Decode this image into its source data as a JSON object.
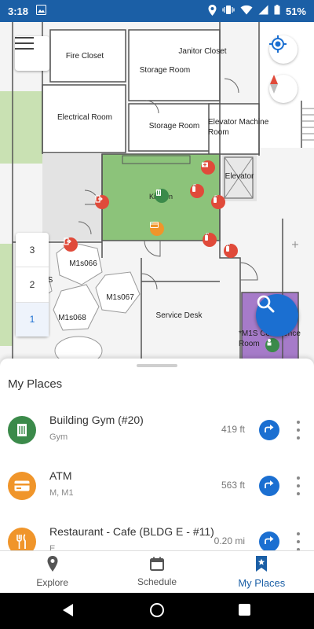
{
  "status_bar": {
    "time": "3:18",
    "battery": "51%"
  },
  "map": {
    "rooms": {
      "fire_closet": "Fire Closet",
      "janitor_closet": "Janitor Closet",
      "storage_room_1": "Storage Room",
      "electrical_room": "Electrical Room",
      "storage_room_2": "Storage Room",
      "elevator_machine_room": "Elevator Machine Room",
      "elevator": "Elevator",
      "kitchen": "Kitchen",
      "m1s066": "M1s066",
      "m1s067": "M1s067",
      "m1s068": "M1s068",
      "service_desk": "Service Desk",
      "conference_room": "*M1S Conference Room",
      "partial_s": "S"
    },
    "floors": [
      "3",
      "2",
      "1"
    ],
    "active_floor": "1",
    "icons": {
      "menu": "menu-icon",
      "locate": "my-location-icon",
      "compass": "compass-icon",
      "search": "search-icon"
    }
  },
  "my_places": {
    "title": "My Places",
    "items": [
      {
        "name": "Building Gym (#20)",
        "category": "Gym",
        "distance": "419 ft",
        "icon": "building-icon",
        "color": "#3b8a4a"
      },
      {
        "name": "ATM",
        "category": "M, M1",
        "distance": "563 ft",
        "icon": "credit-card-icon",
        "color": "#f0952a"
      },
      {
        "name": "Restaurant - Cafe (BLDG E - #11)",
        "category": "E",
        "distance": "0.20 mi",
        "icon": "restaurant-icon",
        "color": "#f0952a"
      }
    ]
  },
  "bottom_nav": {
    "explore": "Explore",
    "schedule": "Schedule",
    "my_places": "My Places",
    "active": "my_places"
  },
  "colors": {
    "brand": "#1b5fa6",
    "accent": "#1b6fd1",
    "kitchen": "#8cc37a",
    "conference": "#a67bc9",
    "green_area": "#c9e1b3"
  }
}
